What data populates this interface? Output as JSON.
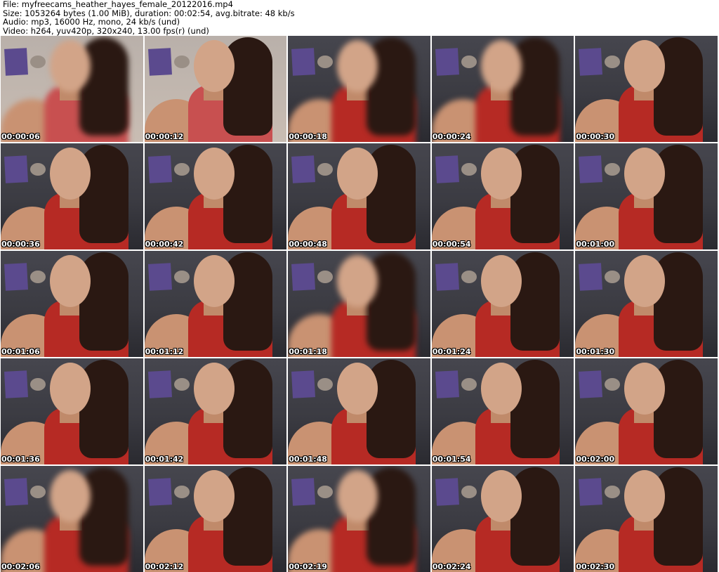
{
  "header": {
    "line1": "File: myfreecams_heather_hayes_female_20122016.mp4",
    "line2": "Size: 1053264 bytes (1.00 MiB), duration: 00:02:54, avg.bitrate: 48 kb/s",
    "line3": "Audio: mp3, 16000 Hz, mono, 24 kb/s (und)",
    "line4": "Video: h264, yuv420p, 320x240, 13.00 fps(r) (und)"
  },
  "thumbnails": [
    {
      "timestamp": "00:00:06"
    },
    {
      "timestamp": "00:00:12"
    },
    {
      "timestamp": "00:00:18"
    },
    {
      "timestamp": "00:00:24"
    },
    {
      "timestamp": "00:00:30"
    },
    {
      "timestamp": "00:00:36"
    },
    {
      "timestamp": "00:00:42"
    },
    {
      "timestamp": "00:00:48"
    },
    {
      "timestamp": "00:00:54"
    },
    {
      "timestamp": "00:01:00"
    },
    {
      "timestamp": "00:01:06"
    },
    {
      "timestamp": "00:01:12"
    },
    {
      "timestamp": "00:01:18"
    },
    {
      "timestamp": "00:01:24"
    },
    {
      "timestamp": "00:01:30"
    },
    {
      "timestamp": "00:01:36"
    },
    {
      "timestamp": "00:01:42"
    },
    {
      "timestamp": "00:01:48"
    },
    {
      "timestamp": "00:01:54"
    },
    {
      "timestamp": "00:02:00"
    },
    {
      "timestamp": "00:02:06"
    },
    {
      "timestamp": "00:02:12"
    },
    {
      "timestamp": "00:02:19"
    },
    {
      "timestamp": "00:02:24"
    },
    {
      "timestamp": "00:02:30"
    }
  ]
}
